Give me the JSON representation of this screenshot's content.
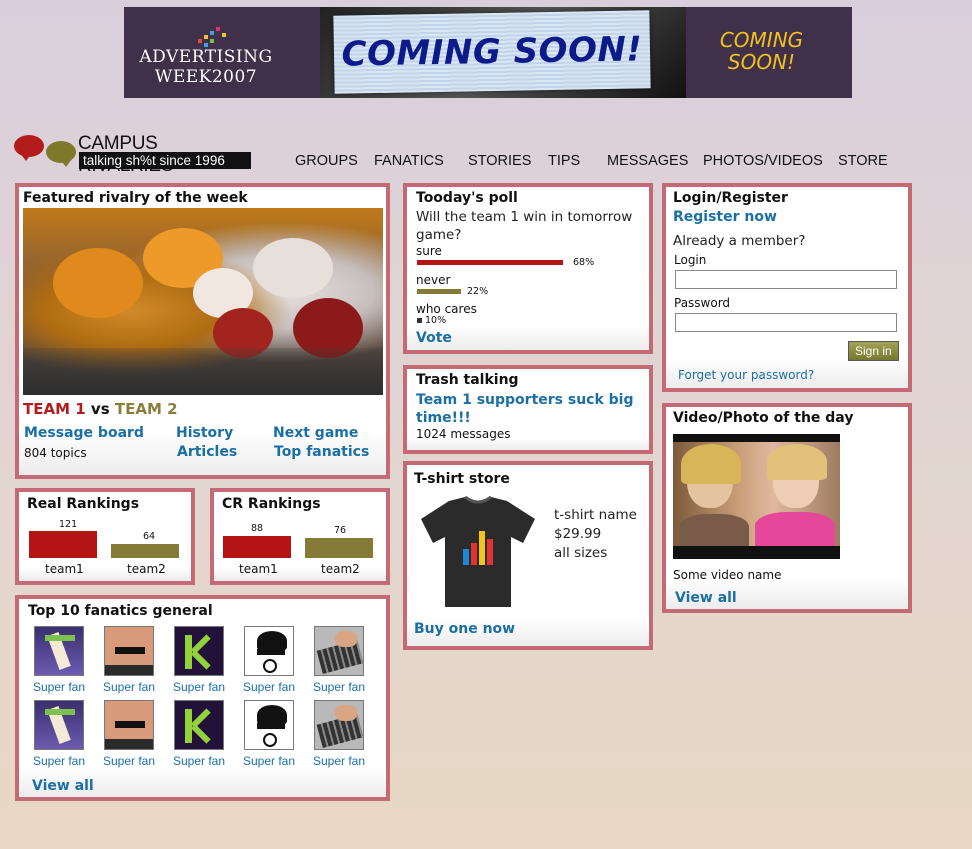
{
  "banner": {
    "brand": "ADVERTISING WEEK2007",
    "brand_line1": "ADVERTISING",
    "brand_line2": "WEEK2007",
    "headline": "COMING SOON!",
    "side": "COMING SOON!",
    "side_line1": "COMING",
    "side_line2": "SOON!"
  },
  "logo": {
    "name": "CAMPUS RIVALRIES",
    "tagline": "talking sh%t since 1996"
  },
  "nav": [
    "GROUPS",
    "FANATICS",
    "STORIES",
    "TIPS",
    "MESSAGES",
    "PHOTOS/VIDEOS",
    "STORE"
  ],
  "featured": {
    "title": "Featured rivalry of the week",
    "team1": "TEAM 1",
    "vs": "vs",
    "team2": "TEAM 2",
    "message_board": "Message board",
    "topics": "804 topics",
    "history": "History",
    "articles": "Articles",
    "next_game": "Next game",
    "top_fanatics": "Top fanatics"
  },
  "real_rankings": {
    "title": "Real Rankings",
    "team1_value": "121",
    "team2_value": "64",
    "team1_label": "team1",
    "team2_label": "team2"
  },
  "cr_rankings": {
    "title": "CR Rankings",
    "team1_value": "88",
    "team2_value": "76",
    "team1_label": "team1",
    "team2_label": "team2"
  },
  "top_fanatics": {
    "title": "Top 10 fanatics general",
    "fan_label": "Super fan",
    "view_all": "View all"
  },
  "poll": {
    "title": "Tooday's poll",
    "question": "Will the team 1 win in tomorrow game?",
    "options": [
      {
        "label": "sure",
        "pct": "68%"
      },
      {
        "label": "never",
        "pct": "22%"
      },
      {
        "label": "who cares",
        "pct": "10%"
      }
    ],
    "vote": "Vote"
  },
  "trash": {
    "title": "Trash talking",
    "headline": "Team 1 supporters suck big time!!!",
    "headline_line1": "Team 1 supporters suck big",
    "headline_line2": "time!!!",
    "messages": "1024 messages"
  },
  "tshirt": {
    "title": "T-shirt store",
    "name": "t-shirt name",
    "price": "$29.99",
    "sizes": "all sizes",
    "buy": "Buy one now"
  },
  "login": {
    "title": "Login/Register",
    "register": "Register now",
    "already": "Already a member?",
    "login_label": "Login",
    "password_label": "Password",
    "signin": "Sign in",
    "forgot": "Forget your password?"
  },
  "video": {
    "title": "Video/Photo of the day",
    "name": "Some video name",
    "view_all": "View all"
  },
  "colors": {
    "accent": "#1a6fa7",
    "team1": "#b41c1c",
    "team2": "#8a7f3a",
    "panel_border": "#c56a74"
  }
}
